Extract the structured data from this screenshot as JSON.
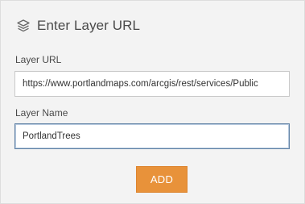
{
  "header": {
    "icon": "layers-icon",
    "title": "Enter Layer URL"
  },
  "form": {
    "url_label": "Layer URL",
    "url_value": "https://www.portlandmaps.com/arcgis/rest/services/Public",
    "name_label": "Layer Name",
    "name_value": "PortlandTrees",
    "add_label": "ADD"
  },
  "colors": {
    "panel_background": "#f3f3f3",
    "button_accent": "#e8923a",
    "focus_border": "#5d7fa3"
  }
}
